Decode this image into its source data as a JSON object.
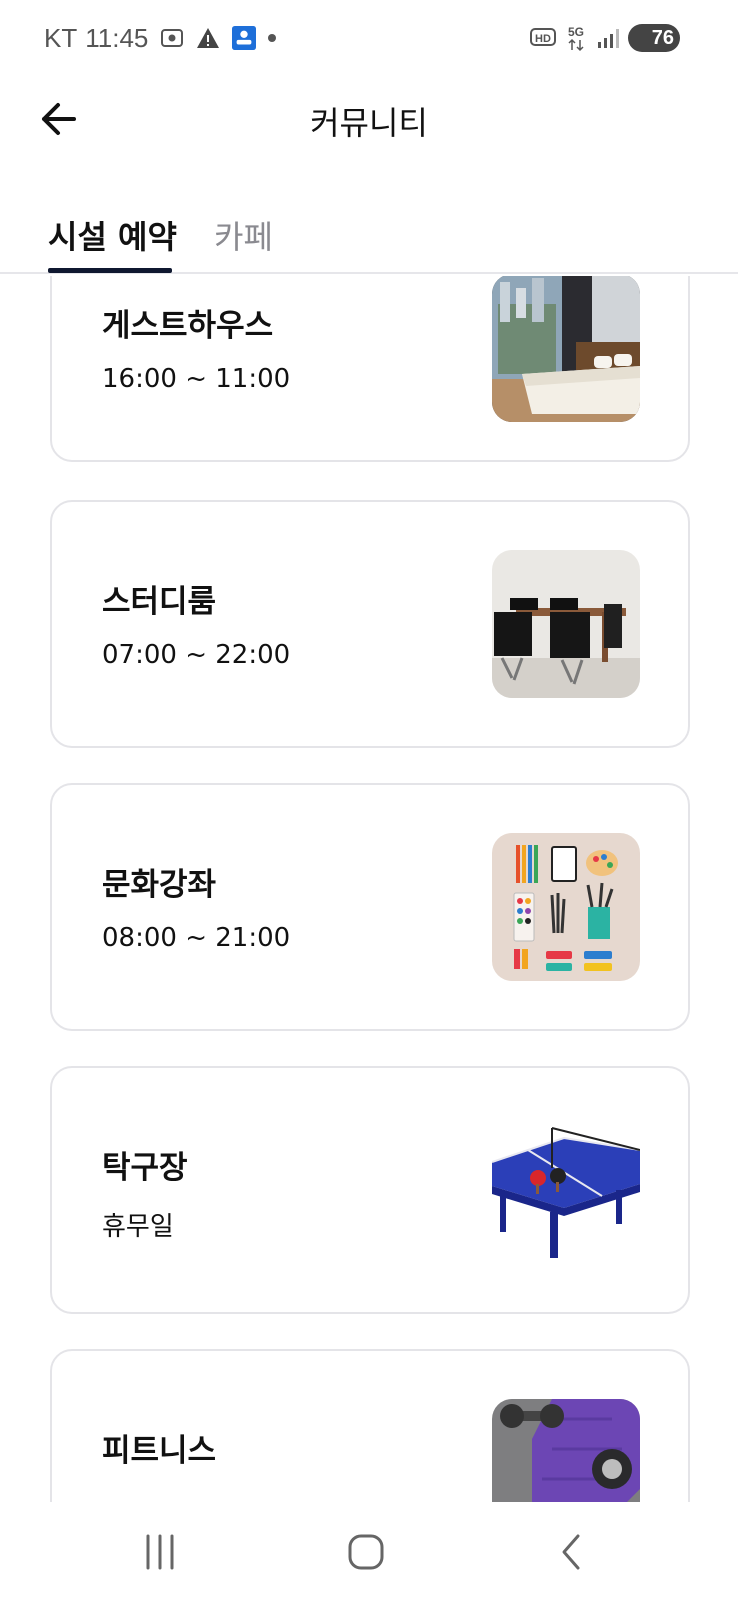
{
  "status_bar": {
    "carrier": "KT",
    "time": "11:45",
    "battery": "76"
  },
  "header": {
    "title": "커뮤니티",
    "back_icon": "arrow-left-icon"
  },
  "tabs": [
    {
      "label": "시설 예약",
      "active": true
    },
    {
      "label": "카페",
      "active": false
    }
  ],
  "facilities": [
    {
      "name": "게스트하우스",
      "hours": "16:00 ~ 11:00",
      "image": "bedroom-image"
    },
    {
      "name": "스터디룸",
      "hours": "07:00 ~ 22:00",
      "image": "meeting-room-image"
    },
    {
      "name": "문화강좌",
      "hours": "08:00 ~ 21:00",
      "image": "art-supplies-image"
    },
    {
      "name": "탁구장",
      "hours": "휴무일",
      "image": "ping-pong-table-image"
    },
    {
      "name": "피트니스",
      "hours": "",
      "image": "gym-equipment-image"
    }
  ],
  "colors": {
    "accent": "#0f1830",
    "card_border": "#e4e4e8",
    "inactive_tab": "#8a8a90"
  },
  "nav_bar": [
    "recent-apps-icon",
    "home-icon",
    "back-icon"
  ]
}
